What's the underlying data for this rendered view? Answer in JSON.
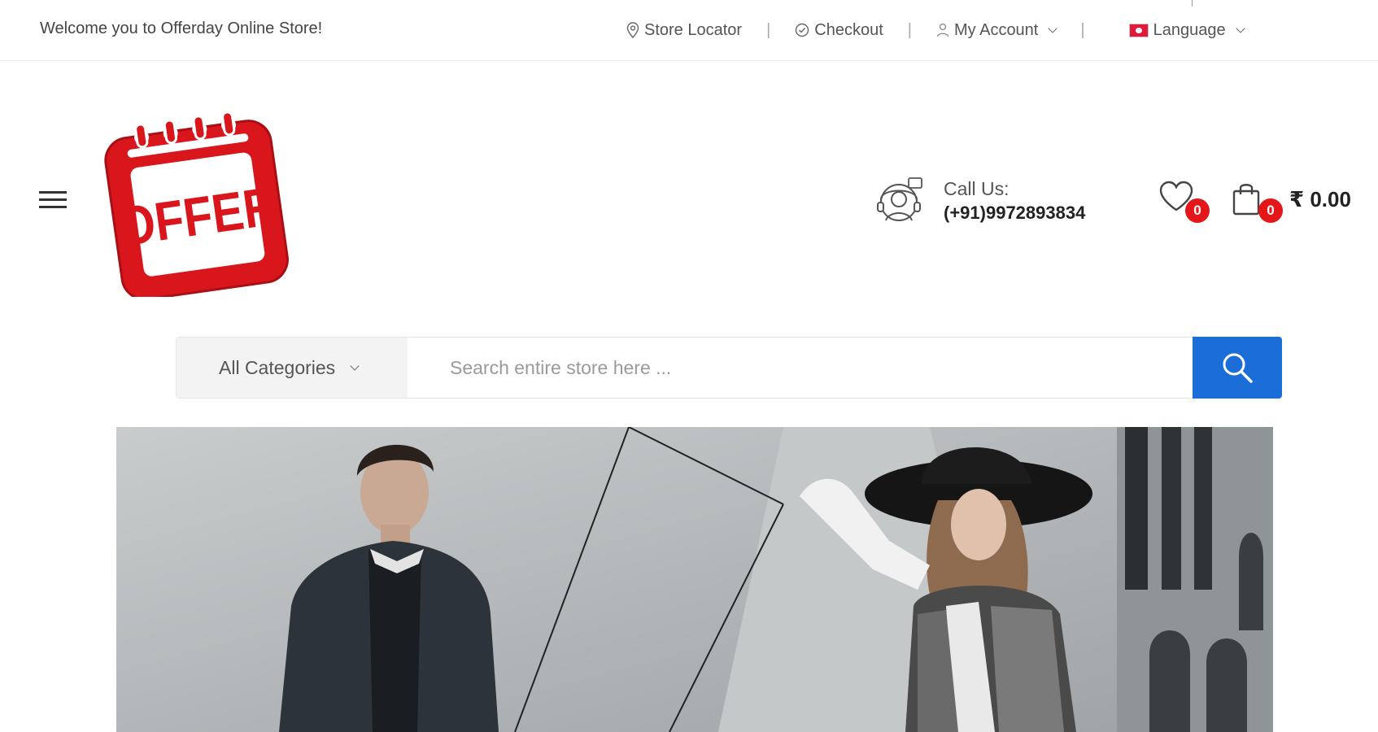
{
  "topbar": {
    "welcome": "Welcome you to Offerday Online Store!",
    "store_locator": "Store Locator",
    "checkout": "Checkout",
    "my_account": "My Account",
    "language": "Language",
    "separator": "|"
  },
  "header": {
    "logo_text": "OFFER",
    "call_label": "Call Us:",
    "call_phone": "(+91)9972893834",
    "wishlist_count": "0",
    "cart_count": "0",
    "cart_total": "₹ 0.00"
  },
  "search": {
    "category": "All Categories",
    "placeholder": "Search entire store here ..."
  },
  "colors": {
    "accent_blue": "#1b6ed8",
    "badge_red": "#e5161a",
    "logo_red": "#d9161c"
  },
  "icons": {
    "location": "location-pin-icon",
    "checkout": "check-circle-icon",
    "account": "user-icon",
    "flag": "flag-icon",
    "menu": "hamburger-icon",
    "support": "headset-support-icon",
    "wishlist": "heart-icon",
    "cart": "shopping-bag-icon",
    "search": "search-icon"
  }
}
